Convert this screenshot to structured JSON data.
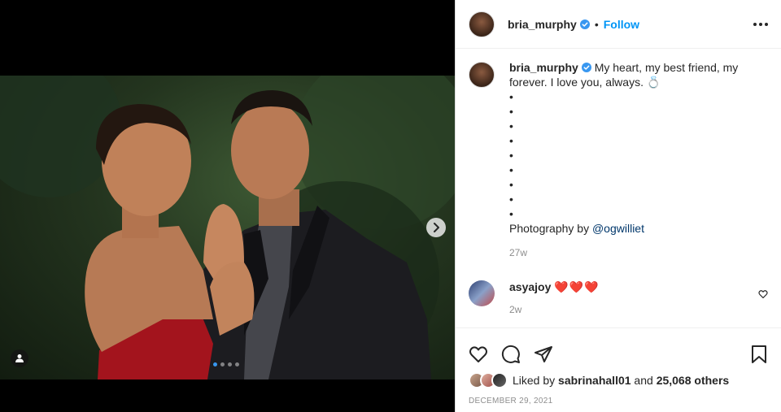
{
  "post": {
    "username": "bria_murphy",
    "separator": "•",
    "follow_label": "Follow",
    "caption_text": "My heart, my best friend, my forever. I love you, always. 💍",
    "bullets": [
      "•",
      "•",
      "•",
      "•",
      "•",
      "•",
      "•",
      "•",
      "•"
    ],
    "photo_credit_prefix": "Photography by ",
    "photo_credit_mention": "@ogwilliet",
    "caption_time": "27w",
    "likes_prefix": "Liked by ",
    "likes_user": "sabrinahall01",
    "likes_mid": " and ",
    "likes_count": "25,068 others",
    "date": "December 29, 2021"
  },
  "comment": {
    "username": "asyajoy",
    "text": "❤️❤️❤️",
    "time": "2w"
  },
  "carousel": {
    "total_slides": 4,
    "current_slide": 1
  },
  "colors": {
    "accent": "#0095f6",
    "verified": "#3897f0",
    "text": "#262626",
    "muted": "#8e8e8e"
  },
  "icons": {
    "like": "heart-icon",
    "comment": "comment-icon",
    "share": "paper-plane-icon",
    "save": "bookmark-icon",
    "more": "more-options-icon",
    "next": "chevron-right-icon",
    "tag": "user-tag-icon",
    "verified": "verified-badge-icon"
  }
}
